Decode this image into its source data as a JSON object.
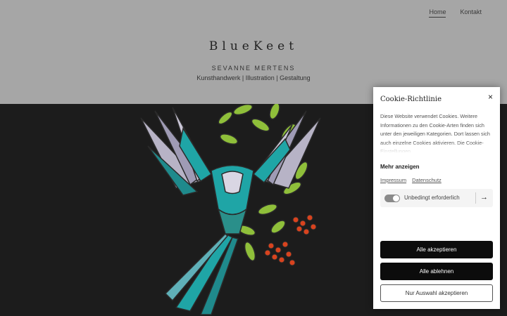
{
  "nav": {
    "home": "Home",
    "contact": "Kontakt"
  },
  "header": {
    "brand": "BlueKeet",
    "subtitle": "SEVANNE MERTENS",
    "tagline": "Kunsthandwerk | Illustration | Gestaltung"
  },
  "cookie": {
    "title": "Cookie-Richtlinie",
    "close": "×",
    "text": "Diese Website verwendet Cookies. Weitere Informationen zu den Cookie-Arten finden sich unter den jeweiligen Kategorien. Dort lassen sich auch einzelne Cookies aktivieren. Die Cookie-Einstellungen",
    "more": "Mehr anzeigen",
    "impressum": "Impressum",
    "datenschutz": "Datenschutz",
    "category_label": "Unbedingt erforderlich",
    "category_enabled": true,
    "arrow_icon": "arrow-right-icon",
    "accept_all": "Alle akzeptieren",
    "reject_all": "Alle ablehnen",
    "accept_selection": "Nur Auswahl akzeptieren"
  },
  "colors": {
    "header_bg": "#a6a6a6",
    "hero_bg": "#1c1c1c",
    "teal": "#1fa5a6",
    "leaf": "#8fbf3a",
    "berry": "#d8431e"
  }
}
